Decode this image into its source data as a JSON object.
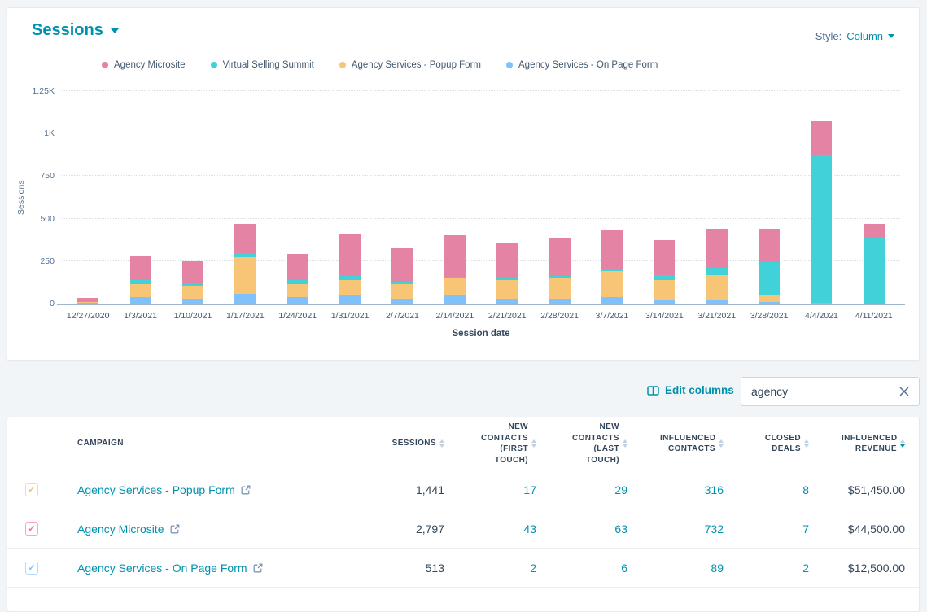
{
  "chart_card": {
    "title": "Sessions",
    "style_label": "Style:",
    "style_value": "Column"
  },
  "chart_data": {
    "type": "bar",
    "stacked": true,
    "title": "Sessions",
    "xlabel": "Session date",
    "ylabel": "Sessions",
    "ylim": [
      0,
      1250
    ],
    "grid": "dotted horizontal",
    "legend_position": "top",
    "yticks": [
      {
        "label": "0",
        "value": 0
      },
      {
        "label": "250",
        "value": 250
      },
      {
        "label": "500",
        "value": 500
      },
      {
        "label": "750",
        "value": 750
      },
      {
        "label": "1K",
        "value": 1000
      },
      {
        "label": "1.25K",
        "value": 1250
      }
    ],
    "categories": [
      "12/27/2020",
      "1/3/2021",
      "1/10/2021",
      "1/17/2021",
      "1/24/2021",
      "1/31/2021",
      "2/7/2021",
      "2/14/2021",
      "2/21/2021",
      "2/28/2021",
      "3/7/2021",
      "3/14/2021",
      "3/21/2021",
      "3/28/2021",
      "4/4/2021",
      "4/11/2021"
    ],
    "series": [
      {
        "name": "Agency Services - On Page Form",
        "color": "#7fc2fb",
        "values": [
          5,
          37,
          24,
          59,
          38,
          49,
          29,
          49,
          29,
          26,
          38,
          18,
          21,
          10,
          5,
          0
        ]
      },
      {
        "name": "Agency Services - Popup Form",
        "color": "#f8c475",
        "values": [
          5,
          80,
          77,
          215,
          78,
          91,
          87,
          98,
          111,
          126,
          155,
          122,
          147,
          36,
          0,
          0
        ]
      },
      {
        "name": "Virtual Selling Summit",
        "color": "#41d1d8",
        "values": [
          0,
          24,
          21,
          25,
          24,
          23,
          15,
          13,
          15,
          13,
          11,
          28,
          44,
          199,
          870,
          390
        ]
      },
      {
        "name": "Agency Microsite",
        "color": "#e583a4",
        "values": [
          25,
          141,
          126,
          172,
          154,
          250,
          196,
          242,
          198,
          221,
          226,
          208,
          229,
          196,
          200,
          80
        ]
      }
    ],
    "legend": [
      {
        "label": "Agency Microsite",
        "color": "#e583a4"
      },
      {
        "label": "Virtual Selling Summit",
        "color": "#41d1d8"
      },
      {
        "label": "Agency Services - Popup Form",
        "color": "#f8c475"
      },
      {
        "label": "Agency Services - On Page Form",
        "color": "#7fc2fb"
      }
    ]
  },
  "table_controls": {
    "edit_columns_label": "Edit columns",
    "search_value": "agency"
  },
  "table": {
    "columns": [
      {
        "key": "campaign",
        "header": "CAMPAIGN",
        "align": "left",
        "sortable": false,
        "link": true
      },
      {
        "key": "sessions",
        "header": "SESSIONS",
        "align": "right",
        "sortable": true,
        "link": false
      },
      {
        "key": "new_contacts_first_touch",
        "header": "NEW CONTACTS (FIRST TOUCH)",
        "align": "right",
        "sortable": true,
        "link": true
      },
      {
        "key": "new_contacts_last_touch",
        "header": "NEW CONTACTS (LAST TOUCH)",
        "align": "right",
        "sortable": true,
        "link": true
      },
      {
        "key": "influenced_contacts",
        "header": "INFLUENCED CONTACTS",
        "align": "right",
        "sortable": true,
        "link": true
      },
      {
        "key": "closed_deals",
        "header": "CLOSED DEALS",
        "align": "right",
        "sortable": true,
        "link": true
      },
      {
        "key": "influenced_revenue",
        "header": "INFLUENCED REVENUE",
        "align": "right",
        "sortable": true,
        "link": false,
        "sorted": "desc"
      }
    ],
    "rows": [
      {
        "checked": true,
        "checkbox_color": "#f5c26b",
        "campaign": "Agency Services - Popup Form",
        "sessions": "1,441",
        "new_contacts_first_touch": "17",
        "new_contacts_last_touch": "29",
        "influenced_contacts": "316",
        "closed_deals": "8",
        "influenced_revenue": "$51,450.00"
      },
      {
        "checked": true,
        "checkbox_color": "#f2718c",
        "campaign": "Agency Microsite",
        "sessions": "2,797",
        "new_contacts_first_touch": "43",
        "new_contacts_last_touch": "63",
        "influenced_contacts": "732",
        "closed_deals": "7",
        "influenced_revenue": "$44,500.00"
      },
      {
        "checked": true,
        "checkbox_color": "#7fc2fb",
        "campaign": "Agency Services - On Page Form",
        "sessions": "513",
        "new_contacts_first_touch": "2",
        "new_contacts_last_touch": "6",
        "influenced_contacts": "89",
        "closed_deals": "2",
        "influenced_revenue": "$12,500.00"
      }
    ]
  },
  "icons": {
    "title_dropdown": "chevron-down-icon",
    "style_dropdown": "chevron-down-icon",
    "edit_columns": "table-columns-icon",
    "search_clear": "close-icon",
    "campaign_link": "external-link-icon",
    "sort": "sort-arrows-icon",
    "checkbox_check": "check-icon"
  },
  "colors": {
    "accent_teal": "#0091ae",
    "text_dark": "#33475b",
    "text_gray": "#516f90",
    "background": "#f2f5f8",
    "series_pink": "#e583a4",
    "series_teal": "#41d1d8",
    "series_orange": "#f8c475",
    "series_blue": "#7fc2fb"
  }
}
